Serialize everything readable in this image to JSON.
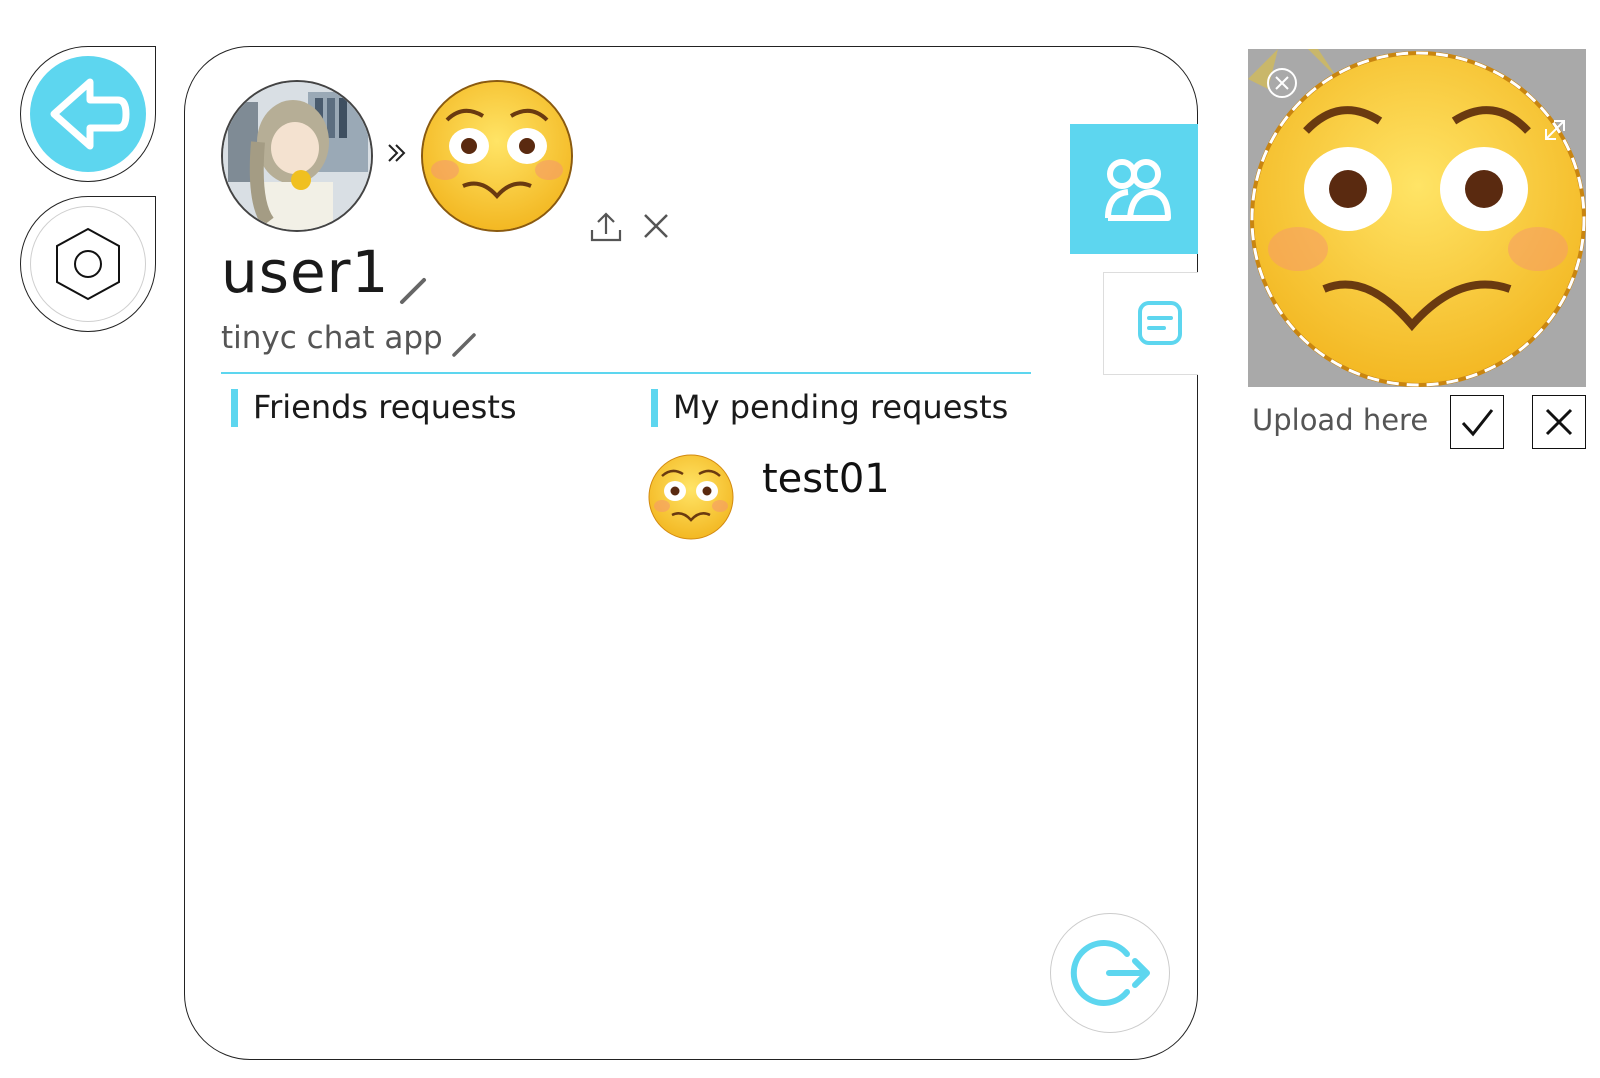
{
  "nav": {
    "back_icon": "arrow-left-icon",
    "settings_icon": "hexagon-settings-icon"
  },
  "profile": {
    "username": "user1",
    "status": "tinyc chat app",
    "edit_icon": "pencil-icon",
    "upload_icon": "upload-icon",
    "remove_icon": "close-icon",
    "arrow_icon": "double-chevron-right-icon"
  },
  "sections": {
    "friends_requests": "Friends requests",
    "my_pending_requests": "My pending requests"
  },
  "pending_requests": [
    {
      "name": "test01"
    }
  ],
  "tabs": {
    "contacts_icon": "users-icon",
    "chats_icon": "chat-bubble-icon"
  },
  "logout_icon": "logout-icon",
  "upload_panel": {
    "label": "Upload here",
    "confirm_icon": "check-icon",
    "cancel_icon": "close-icon"
  },
  "colors": {
    "accent": "#5dd6ef",
    "border": "#222222",
    "text": "#1a1a1a",
    "muted": "#555555"
  }
}
